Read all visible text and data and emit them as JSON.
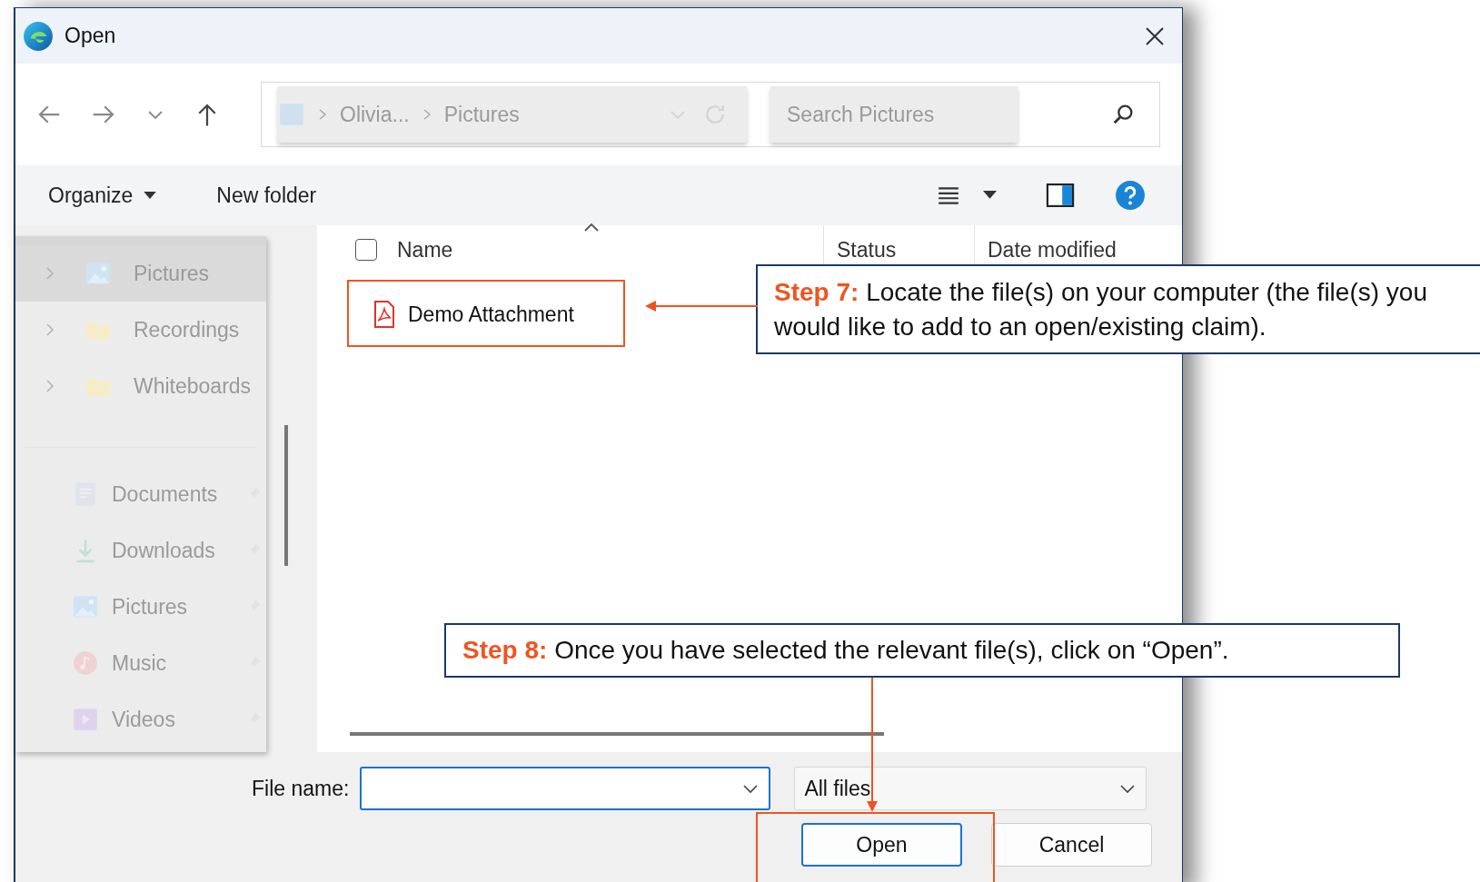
{
  "window": {
    "title": "Open"
  },
  "navigation": {
    "breadcrumb": [
      "Olivia...",
      "Pictures"
    ],
    "search": {
      "placeholder": "Search Pictures"
    }
  },
  "toolbar": {
    "organize": "Organize",
    "new_folder": "New folder"
  },
  "sidebar": {
    "tree": [
      {
        "label": "Pictures",
        "kind": "pictures",
        "selected": true
      },
      {
        "label": "Recordings",
        "kind": "folder",
        "selected": false
      },
      {
        "label": "Whiteboards",
        "kind": "folder",
        "selected": false
      }
    ],
    "quick_access": [
      {
        "label": "Documents",
        "kind": "documents"
      },
      {
        "label": "Downloads",
        "kind": "downloads"
      },
      {
        "label": "Pictures",
        "kind": "pictures"
      },
      {
        "label": "Music",
        "kind": "music"
      },
      {
        "label": "Videos",
        "kind": "videos"
      }
    ]
  },
  "file_list": {
    "select_all_checked": false,
    "columns": [
      "Name",
      "Status",
      "Date modified"
    ],
    "files": [
      {
        "name": "Demo Attachment",
        "kind": "pdf"
      }
    ]
  },
  "footer": {
    "file_name_label": "File name:",
    "filter": "All files",
    "buttons": [
      "Open",
      "Cancel"
    ]
  },
  "annotations": [
    {
      "step": "Step 7:",
      "text": "Locate the file(s) on your computer (the file(s) you would like to add to an open/existing claim)."
    },
    {
      "step": "Step 8:",
      "text": "Once you have selected the relevant file(s), click on “Open”."
    }
  ]
}
